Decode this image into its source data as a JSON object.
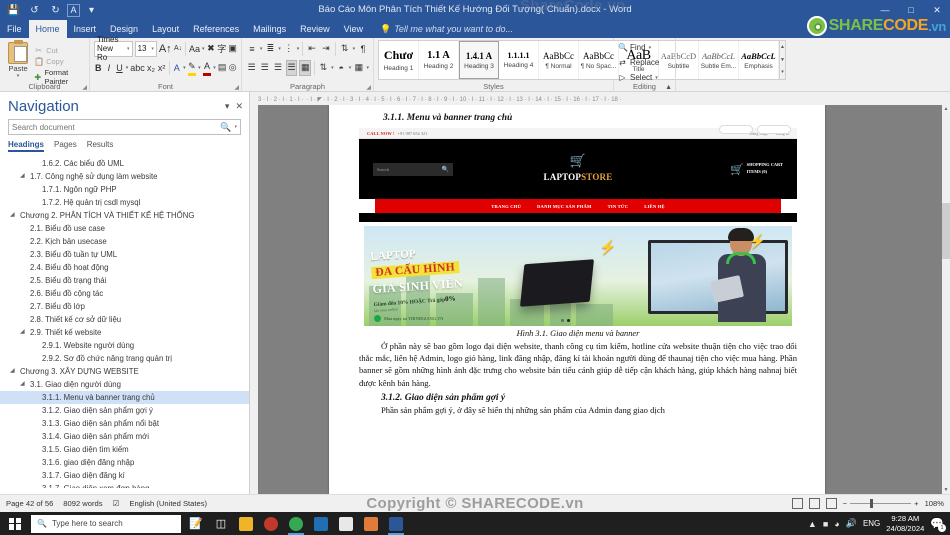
{
  "window": {
    "title": "Báo Cáo Môn Phân Tích Thiết Kế Hướng Đối Tượng( Chuẩn).docx - Word",
    "quick_access": [
      "save-icon",
      "undo-icon",
      "redo-icon",
      "style-a-icon",
      "customize-icon"
    ],
    "controls": [
      "minimize",
      "restore",
      "close"
    ]
  },
  "brand_overlay": {
    "share": "SHARE",
    "code": "CODE",
    "vn": ".vn"
  },
  "watermark": {
    "text": "Copyright © SHARECODE.vn",
    "top": "ShareCode.vn"
  },
  "ribbon": {
    "tabs": [
      {
        "label": "File",
        "active": false
      },
      {
        "label": "Home",
        "active": true
      },
      {
        "label": "Insert",
        "active": false
      },
      {
        "label": "Design",
        "active": false
      },
      {
        "label": "Layout",
        "active": false
      },
      {
        "label": "References",
        "active": false
      },
      {
        "label": "Mailings",
        "active": false
      },
      {
        "label": "Review",
        "active": false
      },
      {
        "label": "View",
        "active": false
      }
    ],
    "tell_me": "Tell me what you want to do...",
    "clipboard": {
      "group_label": "Clipboard",
      "paste": "Paste",
      "cut": "Cut",
      "copy": "Copy",
      "format_painter": "Format Painter"
    },
    "font": {
      "group_label": "Font",
      "font_name": "Times New Ro",
      "font_size": "13",
      "buttons": [
        "grow-font",
        "shrink-font",
        "change-case",
        "clear-formatting",
        "bold",
        "italic",
        "underline",
        "strikethrough",
        "subscript",
        "superscript",
        "text-effects",
        "text-highlight",
        "font-color"
      ]
    },
    "paragraph": {
      "group_label": "Paragraph",
      "buttons": [
        "bullets",
        "numbering",
        "multilevel-list",
        "decrease-indent",
        "increase-indent",
        "sort",
        "show-marks",
        "align-left",
        "align-center",
        "align-right",
        "justify",
        "line-spacing",
        "shading",
        "borders"
      ]
    },
    "styles": {
      "group_label": "Styles",
      "items": [
        {
          "preview": "Chươ",
          "name": "Heading 1",
          "cls": "h1",
          "selected": false
        },
        {
          "preview": "1.1  A",
          "name": "Heading 2",
          "cls": "h2",
          "selected": false
        },
        {
          "preview": "1.4.1  A",
          "name": "Heading 3",
          "cls": "h3",
          "selected": true
        },
        {
          "preview": "1.1.1.1",
          "name": "Heading 4",
          "cls": "h4",
          "selected": false
        },
        {
          "preview": "AaBbCc",
          "name": "¶ Normal",
          "cls": "norm",
          "selected": false
        },
        {
          "preview": "AaBbCc",
          "name": "¶ No Spac...",
          "cls": "norm",
          "selected": false
        },
        {
          "preview": "AaB",
          "name": "Title",
          "cls": "title",
          "selected": false
        },
        {
          "preview": "AaBbCcD",
          "name": "Subtitle",
          "cls": "sub",
          "selected": false
        },
        {
          "preview": "AaBbCcL",
          "name": "Subtle Em...",
          "cls": "subem",
          "selected": false
        },
        {
          "preview": "AaBbCcL",
          "name": "Emphasis",
          "cls": "em",
          "selected": false
        }
      ]
    },
    "editing": {
      "group_label": "Editing",
      "find": "Find",
      "replace": "Replace",
      "select": "Select"
    }
  },
  "navigation": {
    "title": "Navigation",
    "search_placeholder": "Search document",
    "search_value": "",
    "tabs": [
      {
        "label": "Headings",
        "active": true
      },
      {
        "label": "Pages",
        "active": false
      },
      {
        "label": "Results",
        "active": false
      }
    ],
    "items": [
      {
        "label": "1.6.2. Các biểu đồ UML",
        "level": 3,
        "arrow": false,
        "selected": false
      },
      {
        "label": "1.7. Công nghệ sử dụng làm website",
        "level": 2,
        "arrow": true,
        "selected": false
      },
      {
        "label": "1.7.1. Ngôn ngữ PHP",
        "level": 3,
        "arrow": false,
        "selected": false
      },
      {
        "label": "1.7.2. Hệ quản trị csdl mysql",
        "level": 3,
        "arrow": false,
        "selected": false
      },
      {
        "label": "Chương 2. PHÂN TÍCH VÀ THIẾT KẾ HỆ THỐNG",
        "level": 1,
        "arrow": true,
        "selected": false
      },
      {
        "label": "2.1. Biểu đồ use case",
        "level": 2,
        "arrow": false,
        "selected": false
      },
      {
        "label": "2.2. Kịch bản usecase",
        "level": 2,
        "arrow": false,
        "selected": false
      },
      {
        "label": "2.3. Biểu đồ tuần tự UML",
        "level": 2,
        "arrow": false,
        "selected": false
      },
      {
        "label": "2.4. Biểu đồ hoạt động",
        "level": 2,
        "arrow": false,
        "selected": false
      },
      {
        "label": "2.5. Biểu đồ trạng thái",
        "level": 2,
        "arrow": false,
        "selected": false
      },
      {
        "label": "2.6. Biểu đồ cộng tác",
        "level": 2,
        "arrow": false,
        "selected": false
      },
      {
        "label": "2.7. Biểu đồ lớp",
        "level": 2,
        "arrow": false,
        "selected": false
      },
      {
        "label": "2.8. Thiết kế cơ sở dữ liệu",
        "level": 2,
        "arrow": false,
        "selected": false
      },
      {
        "label": "2.9. Thiết kế website",
        "level": 2,
        "arrow": true,
        "selected": false
      },
      {
        "label": "2.9.1. Website người dùng",
        "level": 3,
        "arrow": false,
        "selected": false
      },
      {
        "label": "2.9.2. Sơ đồ chức năng trang quản trị",
        "level": 3,
        "arrow": false,
        "selected": false
      },
      {
        "label": "Chương 3. XÂY DỰNG WEBSITE",
        "level": 1,
        "arrow": true,
        "selected": false
      },
      {
        "label": "3.1. Giao diện người dùng",
        "level": 2,
        "arrow": true,
        "selected": false
      },
      {
        "label": "3.1.1. Menu và banner trang chủ",
        "level": 3,
        "arrow": false,
        "selected": true
      },
      {
        "label": "3.1.2. Giao diện sản phẩm gợi ý",
        "level": 3,
        "arrow": false,
        "selected": false
      },
      {
        "label": "3.1.3. Giao diện sản phẩm nổi bật",
        "level": 3,
        "arrow": false,
        "selected": false
      },
      {
        "label": "3.1.4. Giao diện sản phẩm mới",
        "level": 3,
        "arrow": false,
        "selected": false
      },
      {
        "label": "3.1.5. Giao diện tìm kiếm",
        "level": 3,
        "arrow": false,
        "selected": false
      },
      {
        "label": "3.1.6. giao diện đăng nhập",
        "level": 3,
        "arrow": false,
        "selected": false
      },
      {
        "label": "3.1.7. Giao diện đăng kí",
        "level": 3,
        "arrow": false,
        "selected": false
      },
      {
        "label": "3.1.7. Giao diện xem đơn hàng",
        "level": 3,
        "arrow": false,
        "selected": false
      }
    ]
  },
  "document": {
    "heading": "3.1.1. Menu và banner trang chủ",
    "figure_caption": "Hình 3.1. Giao diện menu và banner",
    "paragraph1": "Ở phần này sẽ bao gồm logo đại diện website, thanh công cụ tìm kiếm, hotline cửa website thuận tiện cho việc trao đổi thắc mắc, liên hệ Admin, logo giỏ hàng, link đăng nhập, đăng kí tài khoản người dùng để thaunaj tiện cho việc mua hàng. Phần banner sẽ gồm những hình ảnh đặc trưng cho website bán tiểu cảnh giúp dễ tiếp cận khách hàng, giúp khách hàng nahnaj biết được kênh bán hàng.",
    "heading2": "3.1.2. Giao diện sản phẩm gợi ý",
    "paragraph2": "Phần sản phẩm gợi ý, ở đây sẽ hiển thị những sản phẩm của Admin đang giao dịch",
    "screenshot": {
      "call_now": "CALL NOW !",
      "phone": "+91 987 654 321",
      "top_links": [
        "Đăng nhập",
        "Đăng kí"
      ],
      "search_placeholder": "Search",
      "brand_first": "LAPTOP",
      "brand_second": "STORE",
      "cart_title": "SHOPPING CART",
      "cart_items": "ITEMS (0)",
      "menu": [
        "TRANG CHỦ",
        "DANH MỤC SẢN PHẨM",
        "TIN TỨC",
        "LIÊN HỆ"
      ]
    },
    "banner": {
      "line1": "LAPTOP",
      "line2": "ĐA CẤU HÌNH",
      "line3": "GIÁ SINH VIÊN",
      "discount": "Giảm đến 10%",
      "or": "HOẶC",
      "installment_label": "Trả góp",
      "installment_value": "0%",
      "note": "khi mua online",
      "footer": "Mua ngay tại THINHGIANG.VN"
    }
  },
  "status_bar": {
    "page": "Page 42 of 56",
    "words": "8092 words",
    "language": "English (United States)",
    "zoom": "108%",
    "views": [
      "read-mode",
      "print-layout",
      "web-layout"
    ]
  },
  "taskbar": {
    "search_placeholder": "Type here to search",
    "apps": [
      "task-view",
      "file-explorer",
      "media-app",
      "chrome-app",
      "vscode-app",
      "store-app",
      "xmind-app",
      "word-app"
    ],
    "tray": {
      "language": "ENG",
      "time": "9:28 AM",
      "date": "24/08/2024",
      "icons": [
        "show-hidden-icons",
        "battery-icon",
        "wifi-icon",
        "volume-icon"
      ]
    }
  }
}
